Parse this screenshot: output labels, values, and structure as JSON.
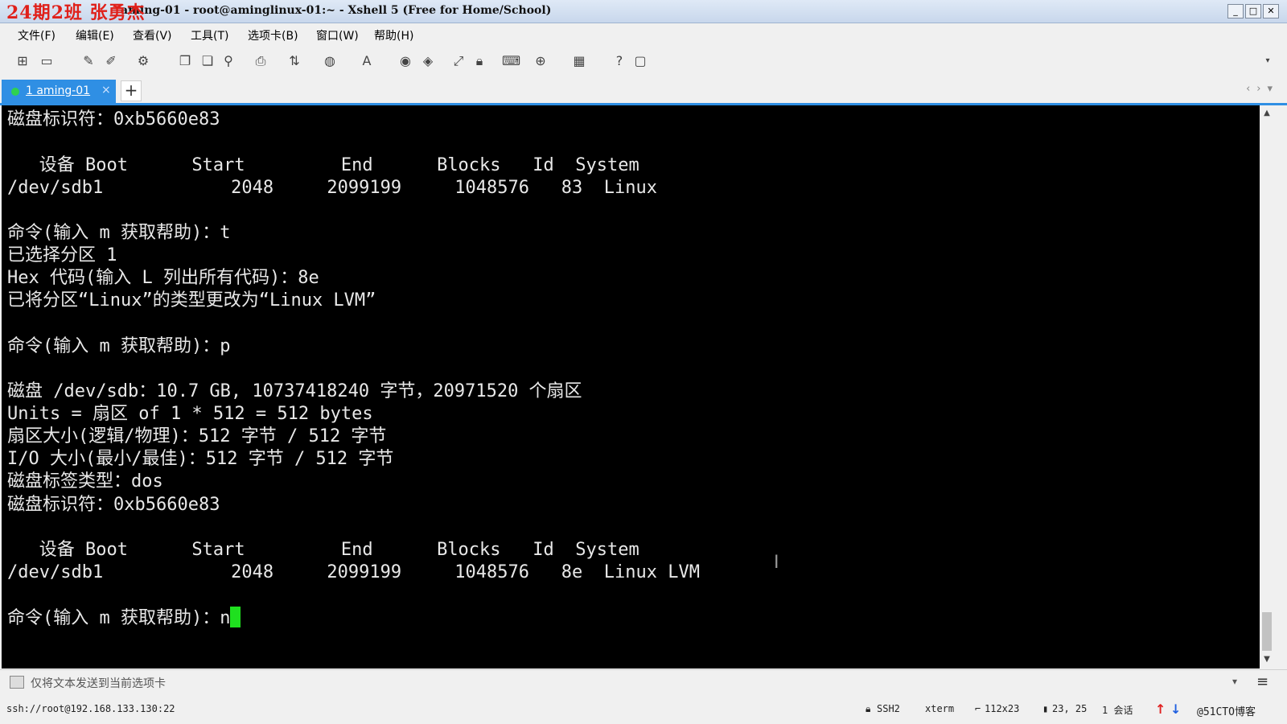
{
  "window": {
    "watermark": "24期2班 张勇杰",
    "title": "aming-01 - root@aminglinux-01:~ - Xshell 5 (Free for Home/School)",
    "buttons": [
      "_",
      "□",
      "✕"
    ]
  },
  "menu": [
    "文件(F)",
    "编辑(E)",
    "查看(V)",
    "工具(T)",
    "选项卡(B)",
    "窗口(W)",
    "帮助(H)"
  ],
  "toolbar_icons": [
    "new-session-icon",
    "open-folder-icon",
    "connect-icon",
    "disconnect-icon",
    "properties-icon",
    "copy-icon",
    "paste-icon",
    "find-icon",
    "print-icon",
    "transfer-icon",
    "globe-icon",
    "font-icon",
    "xftp-icon",
    "xmanager-icon",
    "fullscreen-icon",
    "lock-icon",
    "keyboard-icon",
    "new-tab-icon",
    "layout-icon",
    "help-icon",
    "chat-icon"
  ],
  "tab": {
    "label": "1 aming-01",
    "close": "×",
    "add": "+"
  },
  "terminal": {
    "lines": [
      "磁盘标识符：0xb5660e83",
      "",
      "   设备 Boot      Start         End      Blocks   Id  System",
      "/dev/sdb1            2048     2099199     1048576   83  Linux",
      "",
      "命令(输入 m 获取帮助)：t",
      "已选择分区 1",
      "Hex 代码(输入 L 列出所有代码)：8e",
      "已将分区“Linux”的类型更改为“Linux LVM”",
      "",
      "命令(输入 m 获取帮助)：p",
      "",
      "磁盘 /dev/sdb：10.7 GB, 10737418240 字节，20971520 个扇区",
      "Units = 扇区 of 1 * 512 = 512 bytes",
      "扇区大小(逻辑/物理)：512 字节 / 512 字节",
      "I/O 大小(最小/最佳)：512 字节 / 512 字节",
      "磁盘标签类型：dos",
      "磁盘标识符：0xb5660e83",
      "",
      "   设备 Boot      Start         End      Blocks   Id  System",
      "/dev/sdb1            2048     2099199     1048576   8e  Linux LVM",
      "",
      "命令(输入 m 获取帮助)：n"
    ],
    "cursor_color": "#1fe01f"
  },
  "sendbar": {
    "text": "仅将文本发送到当前选项卡"
  },
  "status": {
    "connection": "ssh://root@192.168.133.130:22",
    "protocol": "SSH2",
    "term": "xterm",
    "size": "112x23",
    "position": "23, 25",
    "sessions": "1 会话",
    "watermark": "@51CTO博客"
  },
  "colors": {
    "accent": "#2f8fe4",
    "terminal_bg": "#000000",
    "terminal_fg": "#e8e8e8",
    "watermark": "#e0201a"
  }
}
